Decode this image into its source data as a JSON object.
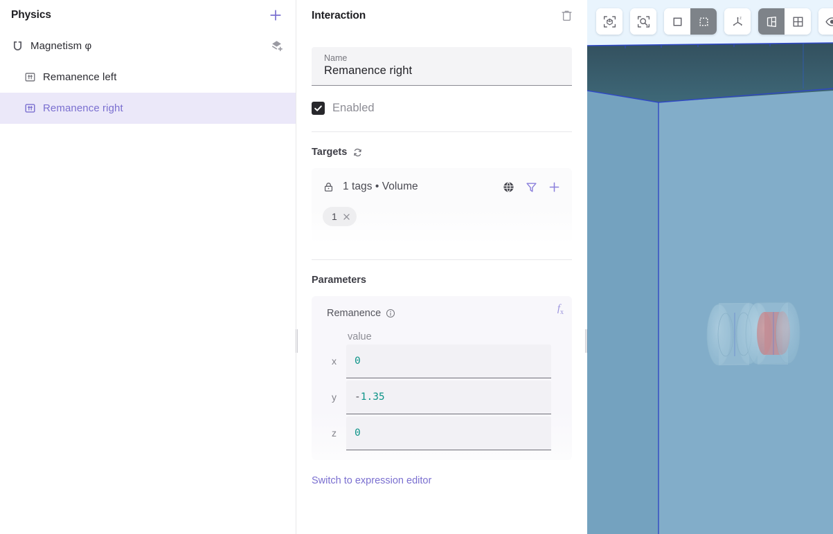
{
  "sidebar": {
    "title": "Physics",
    "add_button": "+",
    "add_icon": "plus-icon",
    "tree": [
      {
        "label": "Magnetism φ",
        "icon": "magnet-icon",
        "level": 1,
        "selected": false,
        "action_icon": "add-layer-icon"
      },
      {
        "label": "Remanence left",
        "icon": "remanence-icon",
        "level": 2,
        "selected": false
      },
      {
        "label": "Remanence right",
        "icon": "remanence-icon",
        "level": 2,
        "selected": true
      }
    ]
  },
  "panel": {
    "title": "Interaction",
    "delete_icon": "trash-icon",
    "name_field": {
      "label": "Name",
      "value": "Remanence right",
      "placeholder": "Name"
    },
    "enabled": {
      "label": "Enabled",
      "checked": true,
      "check_icon": "check-icon"
    },
    "targets": {
      "title": "Targets",
      "refresh_icon": "refresh-icon",
      "lock_icon": "lock-icon",
      "summary": "1 tags • Volume",
      "actions": [
        {
          "name": "globe-icon",
          "label": "globe"
        },
        {
          "name": "filter-icon",
          "label": "filter"
        },
        {
          "name": "plus-icon",
          "label": "add"
        }
      ],
      "chips": [
        {
          "label": "1",
          "remove_icon": "close-icon"
        }
      ]
    },
    "parameters": {
      "title": "Parameters",
      "fx_label": "f",
      "fx_sub": "x",
      "param_name": "Remanence",
      "info_icon": "info-icon",
      "value_header": "value",
      "rows": [
        {
          "axis": "x",
          "value": "0"
        },
        {
          "axis": "y",
          "value": "-1.35"
        },
        {
          "axis": "z",
          "value": "0"
        }
      ],
      "switch_link": "Switch to expression editor"
    }
  },
  "viewport": {
    "toolbar": [
      {
        "group": 1,
        "name": "frame-object-icon",
        "active": false
      },
      {
        "group": 2,
        "name": "zoom-to-fit-icon",
        "active": false
      },
      {
        "group": 3,
        "name": "select-rectangle-icon",
        "active": false
      },
      {
        "group": 3,
        "name": "select-marquee-icon",
        "active": true
      },
      {
        "group": 4,
        "name": "axes-gizmo-icon",
        "active": false
      },
      {
        "group": 5,
        "name": "single-view-icon",
        "active": true
      },
      {
        "group": 5,
        "name": "quad-view-icon",
        "active": false
      },
      {
        "group": 6,
        "name": "visibility-eye-icon",
        "active": false
      }
    ],
    "colors": {
      "sky": "#e8f3fd",
      "ceiling": "#3c5a68",
      "wall": "#7ba8c4",
      "edge": "#2b4fb5",
      "object_body": "#9fc4d8",
      "object_highlight": "#c78b8e"
    }
  }
}
